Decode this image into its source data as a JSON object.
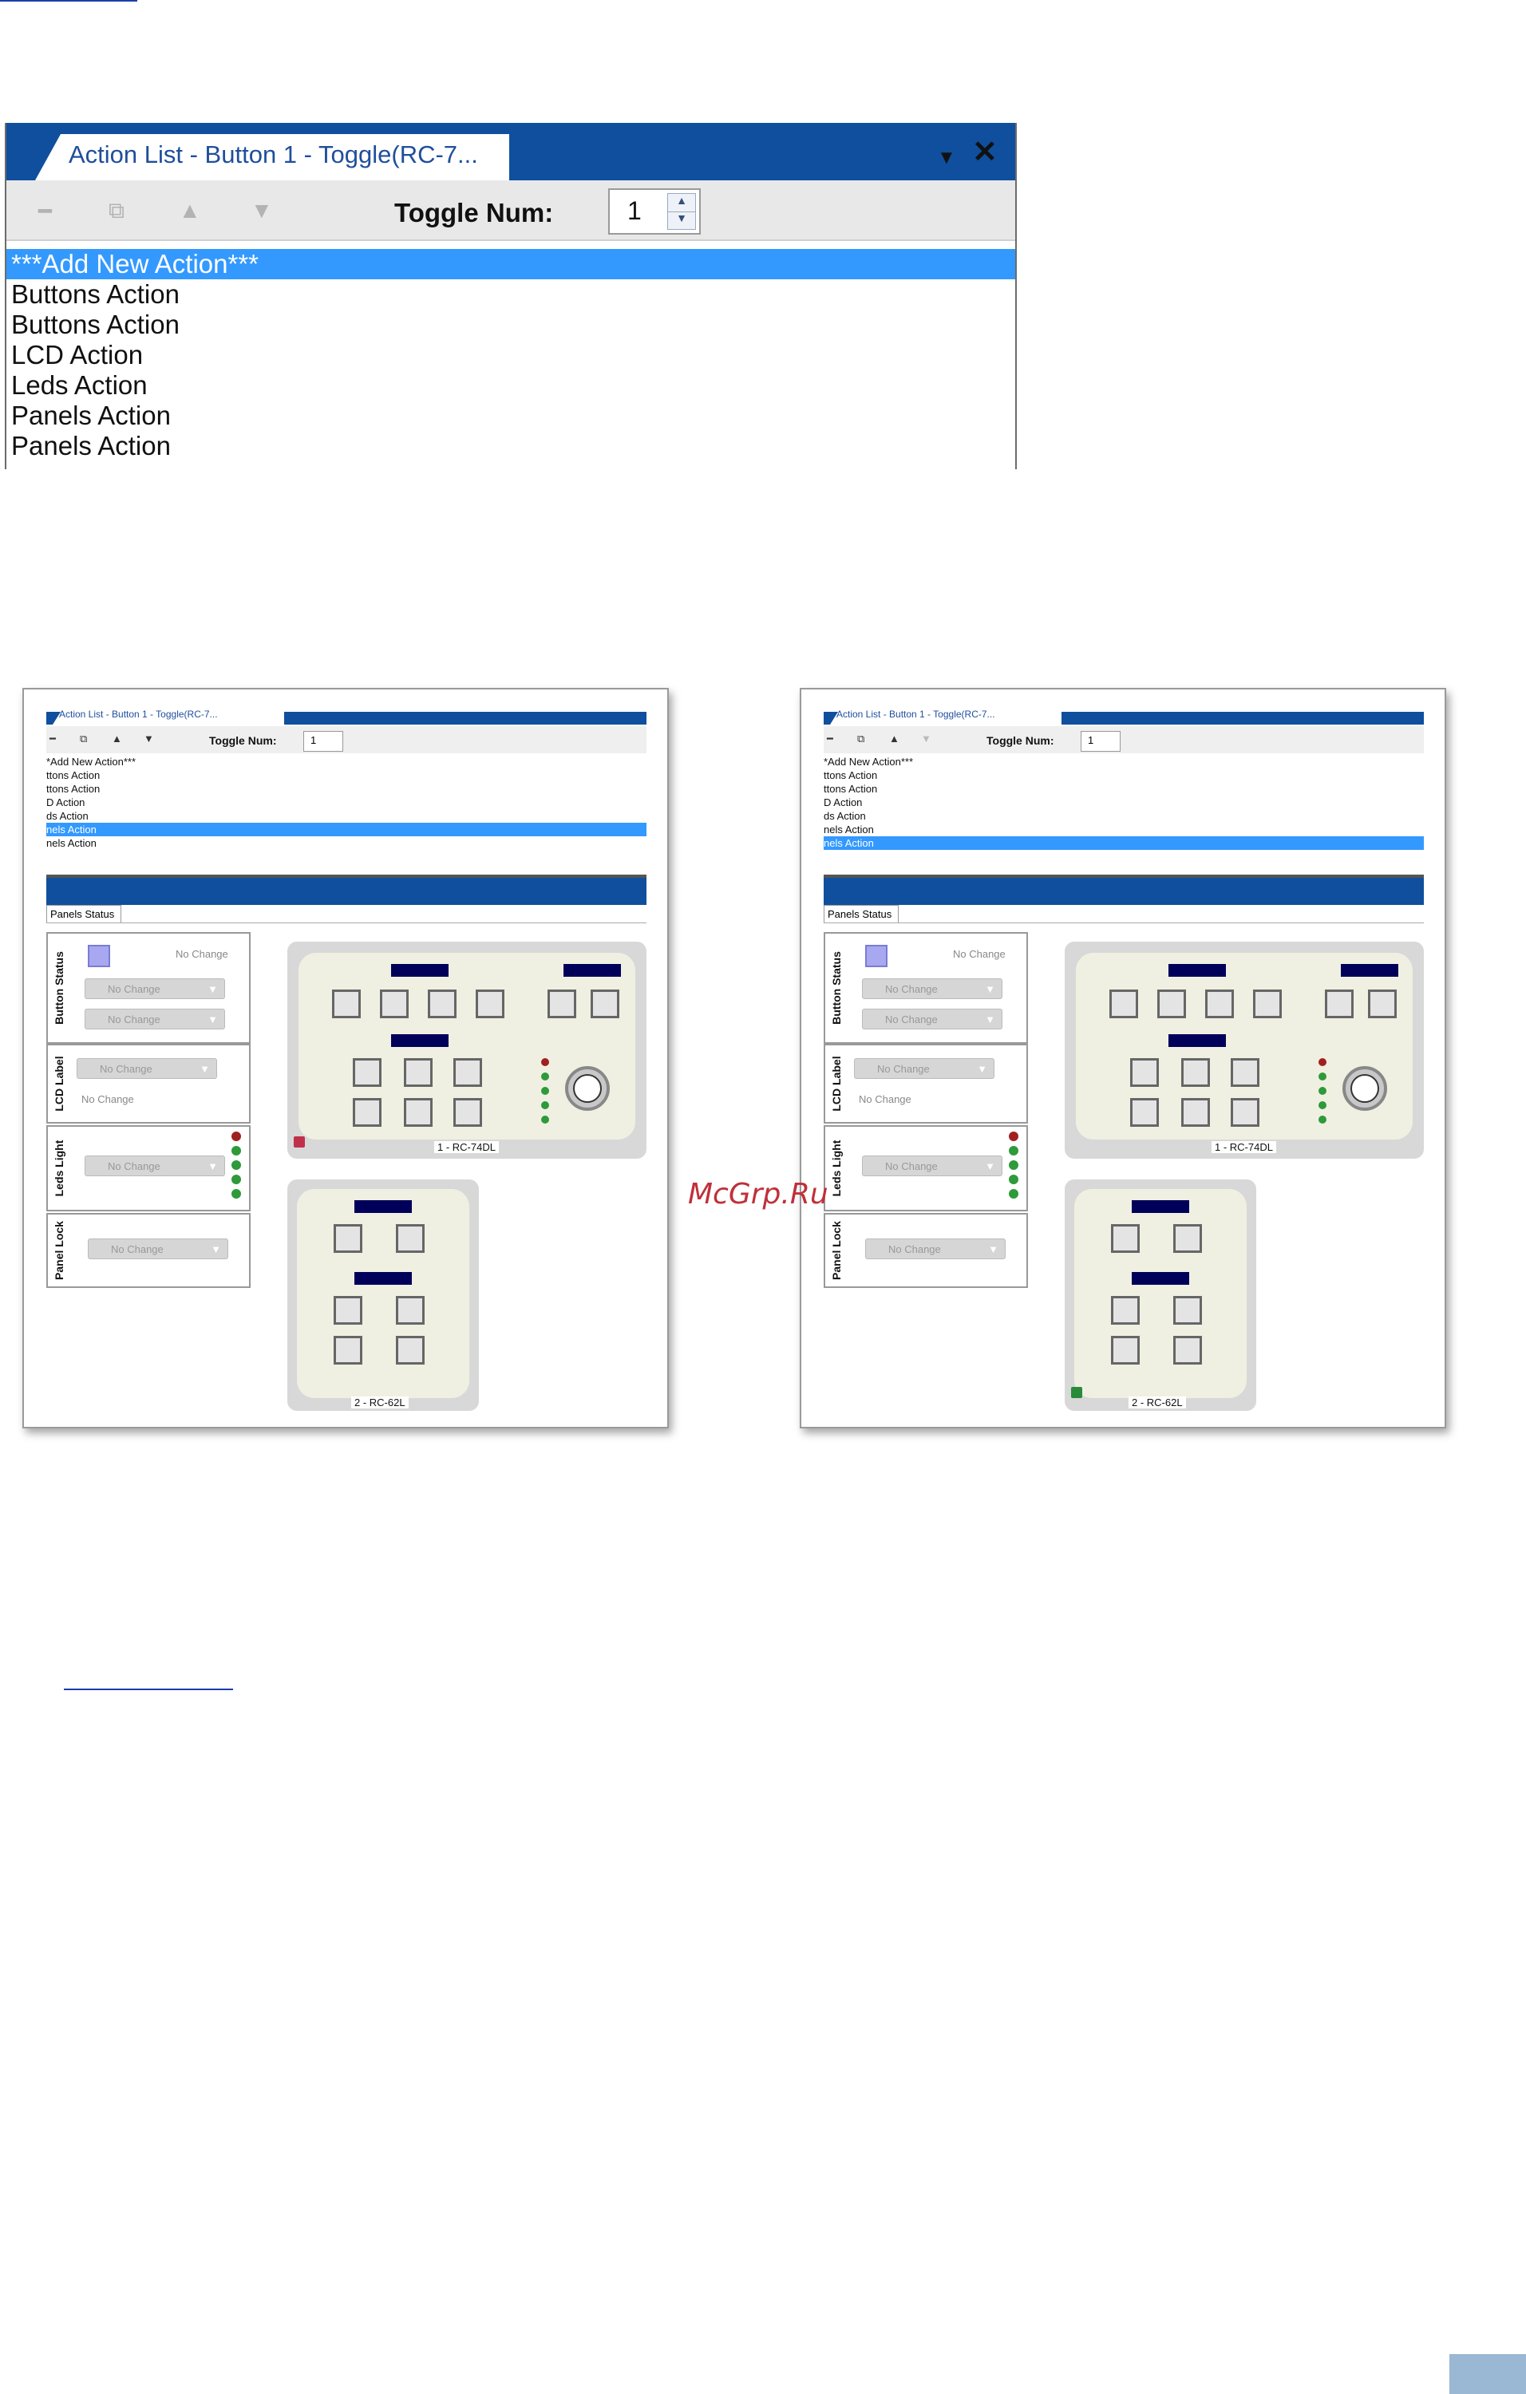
{
  "window": {
    "title": "Action List - Button 1 - Toggle(RC-7...",
    "toggle_label": "Toggle Num:",
    "toggle_value": "1",
    "toolbar": {
      "remove_icon": "remove-icon",
      "copy_icon": "copy-icon",
      "up_icon": "up-arrow-icon",
      "down_icon": "down-arrow-icon"
    },
    "actions": [
      "***Add New Action***",
      "Buttons Action",
      "Buttons Action",
      "LCD Action",
      "Leds Action",
      "Panels Action",
      "Panels Action"
    ],
    "selected_index": 0
  },
  "screenshots": [
    {
      "title": "Action List - Button 1 - Toggle(RC-7...",
      "toggle_label": "Toggle Num:",
      "toggle_value": "1",
      "actions": [
        "*Add New Action***",
        "ttons Action",
        "ttons Action",
        "D Action",
        "ds Action",
        "nels Action",
        "nels Action"
      ],
      "selected_index": 5,
      "tab": "Panels Status",
      "groups": {
        "button_status": "Button Status",
        "lcd_label": "LCD Label",
        "leds_light": "Leds Light",
        "panel_lock": "Panel Lock"
      },
      "no_change": "No Change",
      "panel1": "1 - RC-74DL",
      "panel2": "2 - RC-62L",
      "lock_color": "#c0304a"
    },
    {
      "title": "Action List - Button 1 - Toggle(RC-7...",
      "toggle_label": "Toggle Num:",
      "toggle_value": "1",
      "actions": [
        "*Add New Action***",
        "ttons Action",
        "ttons Action",
        "D Action",
        "ds Action",
        "nels Action",
        "nels Action"
      ],
      "selected_index": 6,
      "tab": "Panels Status",
      "groups": {
        "button_status": "Button Status",
        "lcd_label": "LCD Label",
        "leds_light": "Leds Light",
        "panel_lock": "Panel Lock"
      },
      "no_change": "No Change",
      "panel1": "1 - RC-74DL",
      "panel2": "2 - RC-62L",
      "lock_color": "#2a8a3a"
    }
  ],
  "watermark": "McGrp.Ru",
  "colors": {
    "title_bar": "#0f4f9e",
    "selection": "#3399ff",
    "lcd": "#00005a",
    "led_red": "#a02020",
    "led_green": "#2e9a3a"
  }
}
